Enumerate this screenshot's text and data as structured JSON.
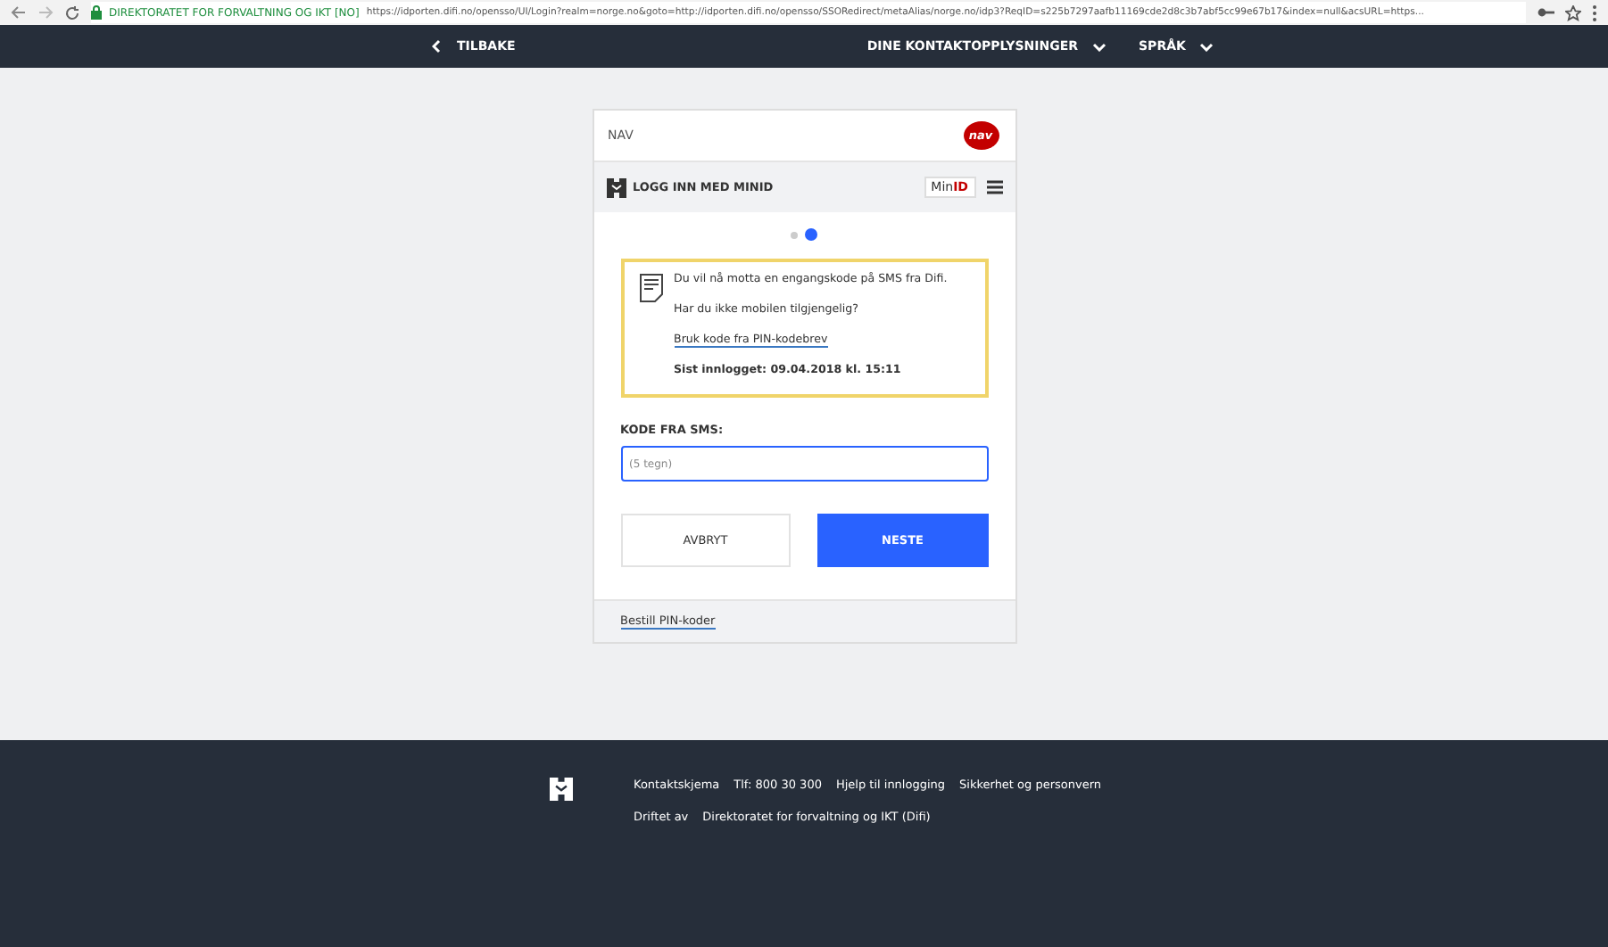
{
  "browser": {
    "site_name": "DIREKTORATET FOR FORVALTNING OG IKT [NO]",
    "url": "https://idporten.difi.no/opensso/UI/Login?realm=norge.no&goto=http://idporten.difi.no/opensso/SSORedirect/metaAlias/norge.no/idp3?ReqID=s225b7297aafb11169cde2d8c3b7abf5cc99e67b17&index=null&acsURL=https..."
  },
  "nav": {
    "back": "TILBAKE",
    "menus": [
      "DINE KONTAKTOPPLYSNINGER",
      "SPRÅK"
    ]
  },
  "card": {
    "provider": "NAV",
    "logo_text": "nav",
    "login_title": "LOGG INN MED MINID",
    "badge_prefix": "Min",
    "badge_suffix": "ID",
    "steps": [
      {
        "selected": false
      },
      {
        "selected": true
      }
    ],
    "notice": {
      "message": "Du vil nå motta en engangskode på SMS fra Difi.",
      "question": "Har du ikke mobilen tilgjengelig?",
      "link": "Bruk kode fra PIN-kodebrev",
      "last_login": "Sist innlogget: 09.04.2018 kl. 15:11"
    },
    "field": {
      "label": "KODE FRA SMS:",
      "placeholder": "(5 tegn)"
    },
    "buttons": [
      {
        "label": "AVBRYT",
        "kind": "secondary"
      },
      {
        "label": "NESTE",
        "kind": "primary"
      }
    ],
    "footer_link": "Bestill PIN-koder"
  },
  "footer": {
    "links": [
      "Kontaktskjema",
      "Tlf: 800 30 300",
      "Hjelp til innlogging",
      "Sikkerhet og personvern"
    ],
    "operated_by": "Driftet av",
    "operator": "Direktoratet for forvaltning og IKT (Difi)"
  }
}
